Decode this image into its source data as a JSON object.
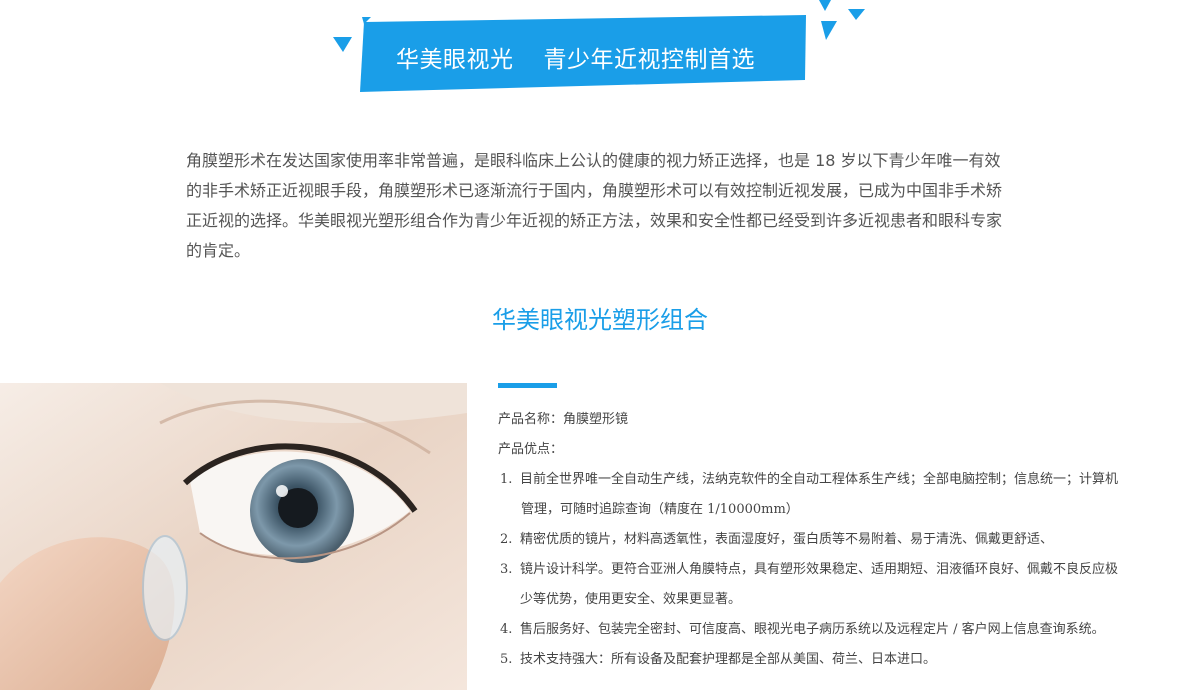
{
  "banner": {
    "brand": "华美眼视光",
    "slogan": "青少年近视控制首选",
    "color": "#1a9ee8"
  },
  "intro_text": "角膜塑形术在发达国家使用率非常普遍，是眼科临床上公认的健康的视力矫正选择，也是 18 岁以下青少年唯一有效的非手术矫正近视眼手段，角膜塑形术已逐渐流行于国内，角膜塑形术可以有效控制近视发展，已成为中国非手术矫正近视的选择。华美眼视光塑形组合作为青少年近视的矫正方法，效果和安全性都已经受到许多近视患者和眼科专家的肯定。",
  "section_title": "华美眼视光塑形组合",
  "product": {
    "name_line": "产品名称：角膜塑形镜",
    "advantages_label": "产品优点：",
    "items": [
      {
        "num": "1.",
        "line1": "目前全世界唯一全自动生产线，法纳克软件的全自动工程体系生产线；全部电脑控制；信息统一；计算机",
        "line2": "管理，可随时追踪查询（精度在 1/10000mm）"
      },
      {
        "num": "2.",
        "line1": "精密优质的镜片，材料高透氧性，表面湿度好，蛋白质等不易附着、易于清洗、佩戴更舒适、",
        "line2": ""
      },
      {
        "num": "3.",
        "line1": "镜片设计科学。更符合亚洲人角膜特点，具有塑形效果稳定、适用期短、泪液循环良好、佩戴不良反应极",
        "line2": "少等优势，使用更安全、效果更显著。"
      },
      {
        "num": "4.",
        "line1": "售后服务好、包装完全密封、可信度高、眼视光电子病历系统以及远程定片 / 客户网上信息查询系统。",
        "line2": ""
      },
      {
        "num": "5.",
        "line1": "技术支持强大：所有设备及配套护理都是全部从美国、荷兰、日本进口。",
        "line2": ""
      }
    ]
  },
  "photo_subject": "eye-contact-lens-photo"
}
